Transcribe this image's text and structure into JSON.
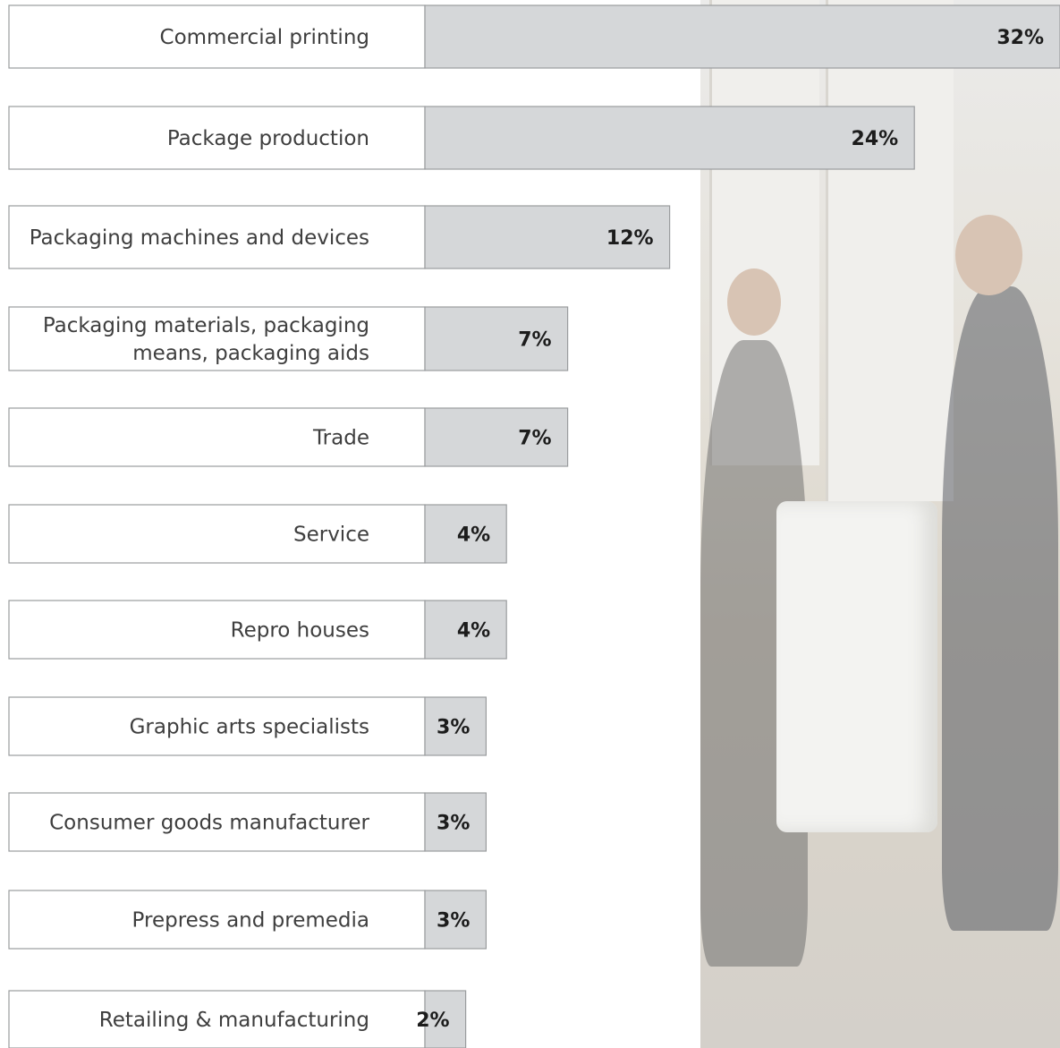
{
  "chart_data": {
    "type": "bar",
    "orientation": "horizontal",
    "categories": [
      "Commercial printing",
      "Package production",
      "Packaging machines and devices",
      "Packaging materials, packaging means, packaging aids",
      "Trade",
      "Service",
      "Repro houses",
      "Graphic arts specialists",
      "Consumer goods manufacturer",
      "Prepress and premedia",
      "Retailing & manufacturing"
    ],
    "category_lines": [
      [
        "Commercial printing"
      ],
      [
        "Package production"
      ],
      [
        "Packaging machines and devices"
      ],
      [
        "Packaging materials, packaging",
        "means, packaging aids"
      ],
      [
        "Trade"
      ],
      [
        "Service"
      ],
      [
        "Repro houses"
      ],
      [
        "Graphic arts specialists"
      ],
      [
        "Consumer goods manufacturer"
      ],
      [
        "Prepress and premedia"
      ],
      [
        "Retailing & manufacturing"
      ]
    ],
    "values": [
      32,
      24,
      12,
      7,
      7,
      4,
      4,
      3,
      3,
      3,
      2
    ],
    "value_labels": [
      "32%",
      "24%",
      "12%",
      "7%",
      "7%",
      "4%",
      "4%",
      "3%",
      "3%",
      "3%",
      "2%"
    ],
    "unit": "%",
    "grid": false,
    "legend": "none",
    "colors": {
      "bar_fill": "#d5d7d9",
      "bar_stroke": "#9a9c9e",
      "label_box_fill": "#ffffff",
      "label_text": "#3e3e3e",
      "value_text": "#1c1c1c"
    }
  }
}
